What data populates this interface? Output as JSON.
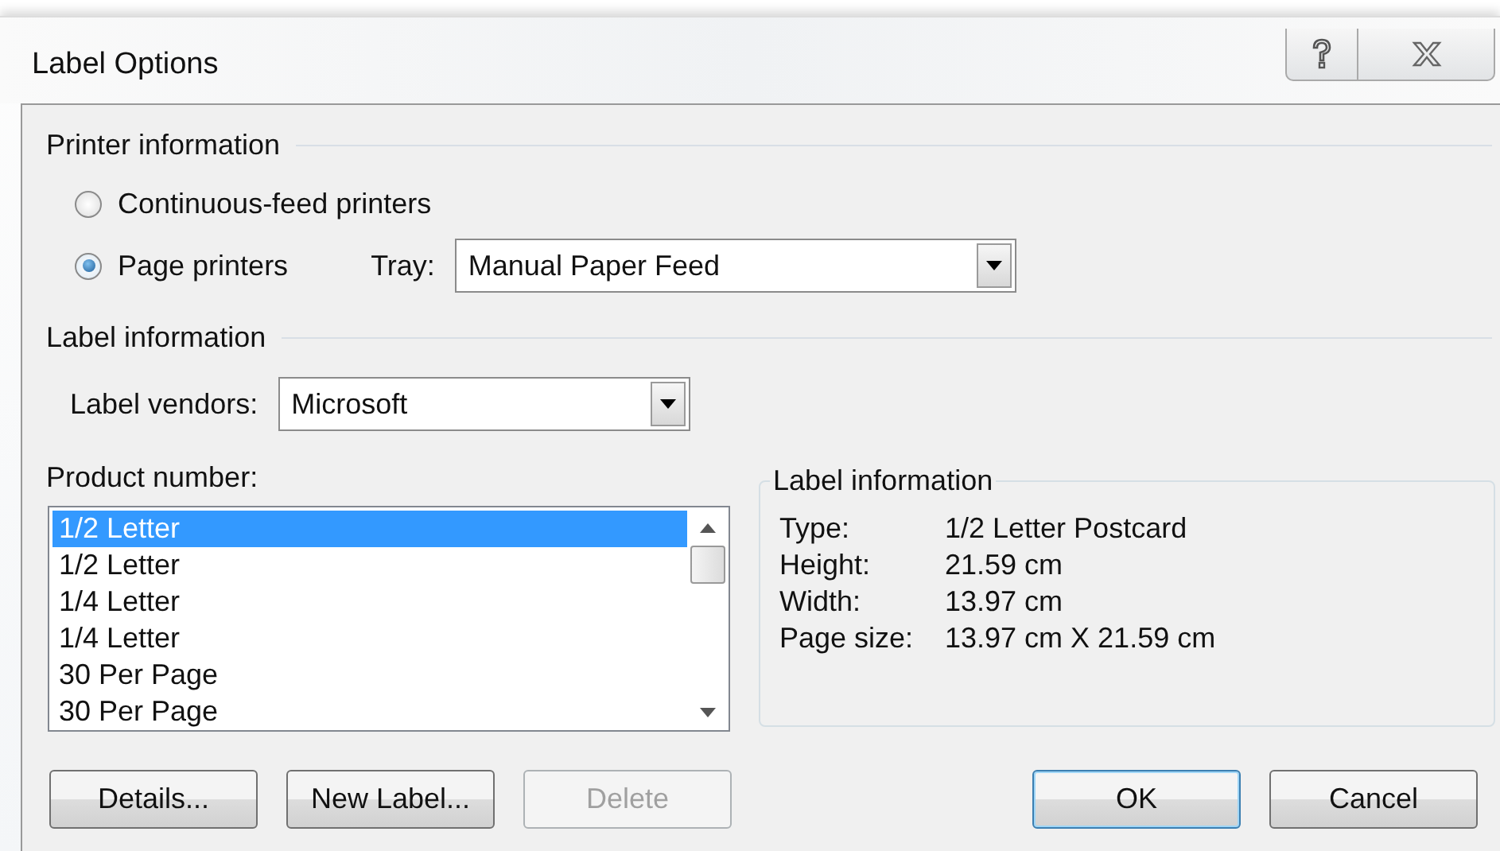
{
  "window": {
    "title": "Label Options"
  },
  "printer_information": {
    "title": "Printer information",
    "options": [
      {
        "label": "Continuous-feed printers",
        "selected": false
      },
      {
        "label": "Page printers",
        "selected": true
      }
    ],
    "tray": {
      "label": "Tray:",
      "value": "Manual Paper Feed"
    }
  },
  "label_information": {
    "title": "Label information",
    "vendors": {
      "label": "Label vendors:",
      "value": "Microsoft"
    }
  },
  "product_number": {
    "label": "Product number:",
    "items": [
      {
        "label": "1/2 Letter",
        "selected": true
      },
      {
        "label": "1/2 Letter",
        "selected": false
      },
      {
        "label": "1/4 Letter",
        "selected": false
      },
      {
        "label": "1/4 Letter",
        "selected": false
      },
      {
        "label": "30 Per Page",
        "selected": false
      },
      {
        "label": "30 Per Page",
        "selected": false
      }
    ]
  },
  "details": {
    "title": "Label information",
    "rows": [
      {
        "name": "Type:",
        "value": "1/2 Letter Postcard"
      },
      {
        "name": "Height:",
        "value": "21.59 cm"
      },
      {
        "name": "Width:",
        "value": "13.97 cm"
      },
      {
        "name": "Page size:",
        "value": "13.97 cm X 21.59 cm"
      }
    ]
  },
  "buttons": [
    {
      "label": "Details...",
      "disabled": false,
      "default": false
    },
    {
      "label": "New Label...",
      "disabled": false,
      "default": false
    },
    {
      "label": "Delete",
      "disabled": true,
      "default": false
    },
    {
      "label": "OK",
      "disabled": false,
      "default": true
    },
    {
      "label": "Cancel",
      "disabled": false,
      "default": false
    }
  ]
}
